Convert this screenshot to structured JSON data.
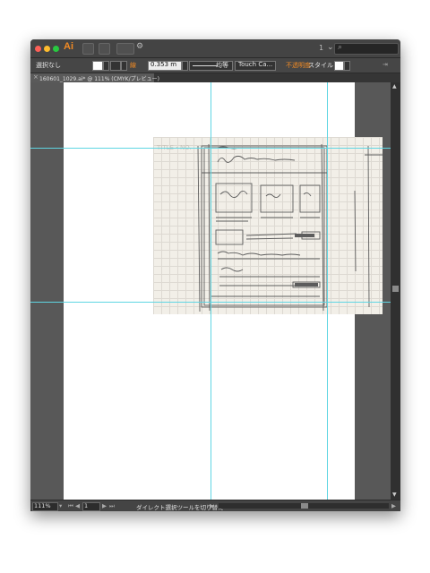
{
  "window": {
    "app_logo": "Ai",
    "traffic_colors": [
      "#fc5f57",
      "#fdbc2e",
      "#28c840"
    ],
    "workspace_number": "1",
    "search_icon": "search-icon"
  },
  "control_bar": {
    "selection_label": "選択なし",
    "stroke_label": "線",
    "stroke_weight": "0.353 m",
    "profile_label": "均等",
    "brush_label": "Touch Ca...",
    "opacity_label": "不透明度",
    "style_label": "スタイル :",
    "accent_color": "#f08a24"
  },
  "document": {
    "tab_title": "160601_1029.ai* @ 111% (CMYK/プレビュー)",
    "close_icon": "close-icon"
  },
  "canvas": {
    "sketch_image": "paper-wireframe-sketch",
    "guide_color": "#5fd6e3"
  },
  "status_bar": {
    "zoom": "111%",
    "artboard_number": "1",
    "tool_hint": "ダイレクト選択ツールを切り替え"
  }
}
